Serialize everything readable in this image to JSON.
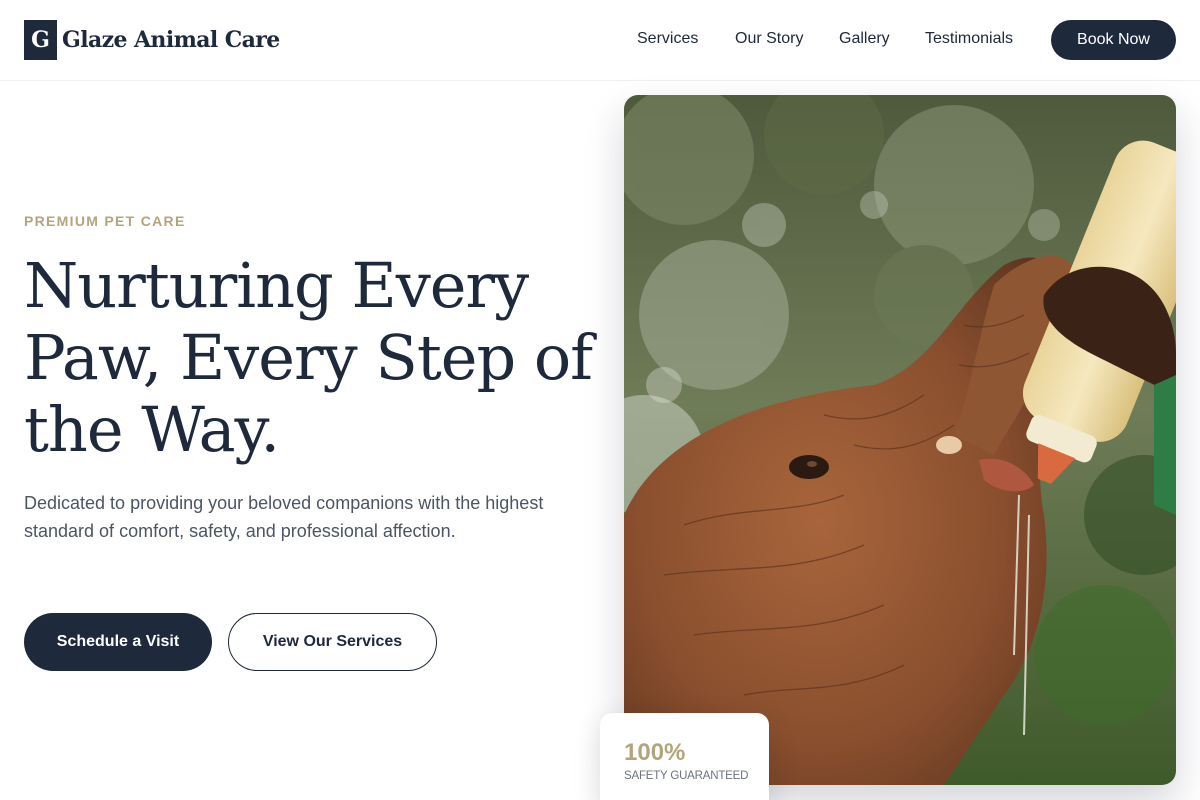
{
  "brand": {
    "mark": "G",
    "name": "Glaze Animal Care"
  },
  "nav": {
    "items": [
      "Services",
      "Our Story",
      "Gallery",
      "Testimonials"
    ],
    "cta": "Book Now"
  },
  "hero": {
    "eyebrow": "PREMIUM PET CARE",
    "headline": "Nurturing Every Paw, Every Step of the Way.",
    "subtext": "Dedicated to providing your beloved companions with the highest standard of comfort, safety, and professional affection.",
    "primary_cta": "Schedule a Visit",
    "secondary_cta": "View Our Services",
    "image_subject": "baby elephant being bottle-fed milk"
  },
  "stat": {
    "value": "100%",
    "label": "SAFETY GUARANTEED"
  },
  "colors": {
    "navy": "#1e293b",
    "gold": "#b2a57e",
    "text_muted": "#4b5563"
  }
}
